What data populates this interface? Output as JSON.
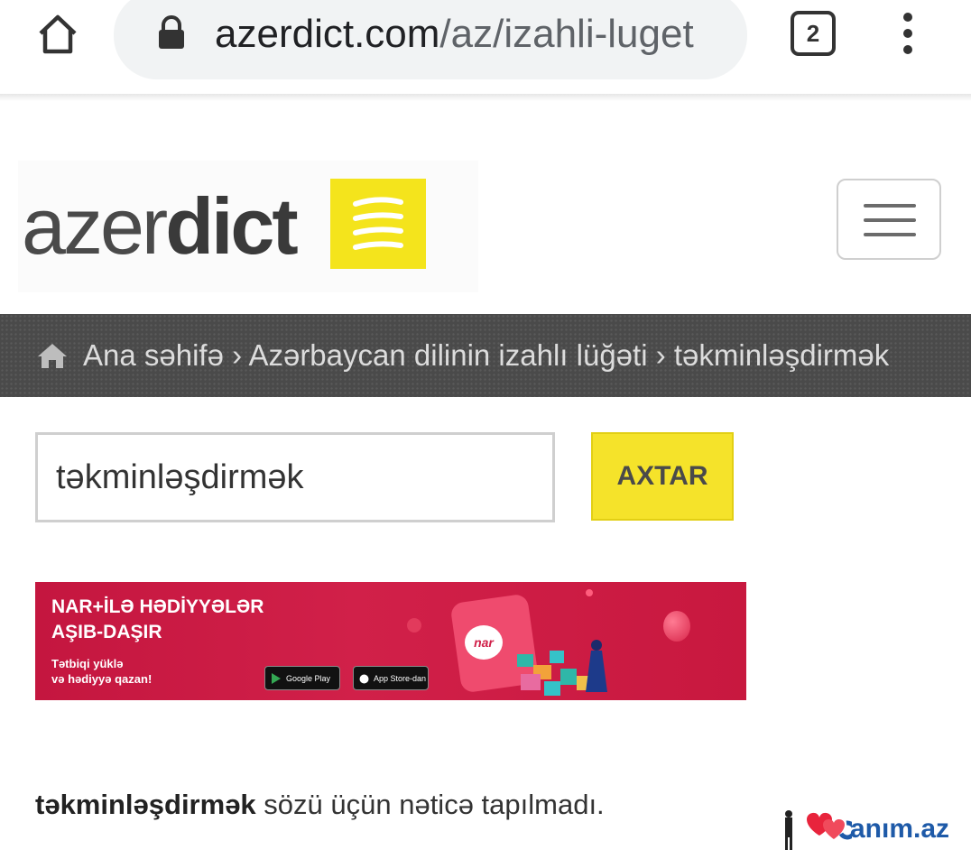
{
  "browser": {
    "url_domain": "azerdict.com",
    "url_path": "/az/izahli-luget",
    "tab_count": "2"
  },
  "header": {
    "logo_light": "azer",
    "logo_bold": "dict"
  },
  "breadcrumb": {
    "text": "Ana səhifə › Azərbaycan dilinin izahlı lüğəti › təkminləşdirmək"
  },
  "search": {
    "value": "təkminləşdirmək",
    "button_label": "AXTAR"
  },
  "banner": {
    "headline_1": "NAR+İLƏ HƏDİYYƏLƏR",
    "headline_2": "AŞIB-DAŞIR",
    "sub_1": "Tətbiqi yüklə",
    "sub_2": "və hədiyyə qazan!",
    "google_play": "Google Play",
    "app_store": "App Store-dan",
    "brand": "nar"
  },
  "result": {
    "word": "təkminləşdirmək",
    "message": " sözü üçün nəticə tapılmadı."
  },
  "watermark": {
    "text": "anım.az"
  },
  "colors": {
    "accent_yellow": "#f5e32a",
    "breadcrumb_bg": "#4a4a4a",
    "banner_red": "#c4163f"
  }
}
